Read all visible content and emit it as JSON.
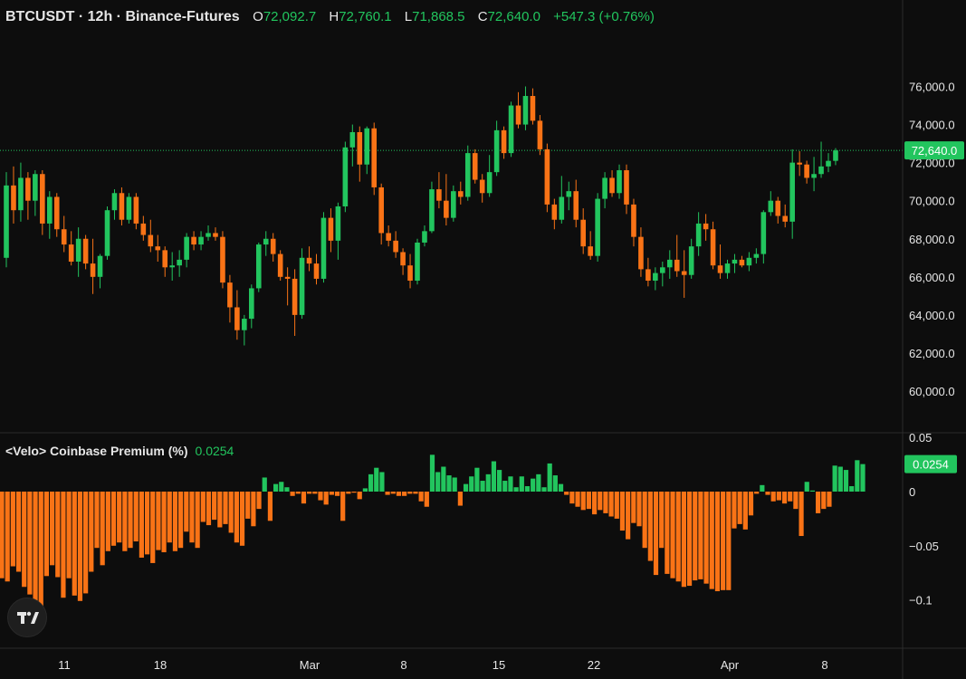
{
  "header": {
    "symbol": "BTCUSDT · 12h · Binance-Futures",
    "o_label": "O",
    "o": "72,092.7",
    "h_label": "H",
    "h": "72,760.1",
    "l_label": "L",
    "l": "71,868.5",
    "c_label": "C",
    "c": "72,640.0",
    "change": "+547.3 (+0.76%)"
  },
  "indicator": {
    "title": "<Velo> Coinbase Premium (%)",
    "value": "0.0254"
  },
  "colors": {
    "up": "#22c55e",
    "down": "#f97316",
    "bg": "#0d0d0d",
    "grid": "#2b2b2b",
    "text": "#e6e6e6"
  },
  "chart_data": [
    {
      "type": "candlestick",
      "ylim": [
        58000,
        76800
      ],
      "y_ticks": [
        "76,000.0",
        "74,000.0",
        "72,000.0",
        "70,000.0",
        "68,000.0",
        "66,000.0",
        "64,000.0",
        "62,000.0",
        "60,000.0"
      ],
      "last_price_label": "72,640.0",
      "last_price": 72640,
      "x_ticks": [
        "11",
        "18",
        "Mar",
        "8",
        "15",
        "22",
        "Apr",
        "8"
      ],
      "candles": [
        [
          67000,
          71500,
          66500,
          70800
        ],
        [
          70800,
          71800,
          68800,
          69500
        ],
        [
          69500,
          72000,
          68900,
          71200
        ],
        [
          71200,
          71500,
          69000,
          70000
        ],
        [
          70000,
          71600,
          69200,
          71400
        ],
        [
          71400,
          71600,
          68200,
          68800
        ],
        [
          68800,
          70500,
          68000,
          70200
        ],
        [
          70200,
          70400,
          68100,
          68500
        ],
        [
          68500,
          69200,
          67300,
          67700
        ],
        [
          67700,
          68400,
          66600,
          66800
        ],
        [
          66800,
          68600,
          66000,
          68000
        ],
        [
          68000,
          68200,
          66400,
          66700
        ],
        [
          66700,
          68000,
          65100,
          66000
        ],
        [
          66000,
          67200,
          65400,
          67100
        ],
        [
          67100,
          69700,
          66900,
          69500
        ],
        [
          69500,
          70600,
          69000,
          70400
        ],
        [
          70400,
          70700,
          68700,
          69000
        ],
        [
          69000,
          70400,
          68800,
          70200
        ],
        [
          70200,
          70400,
          68500,
          68800
        ],
        [
          68800,
          69200,
          67900,
          68200
        ],
        [
          68200,
          69000,
          67300,
          67600
        ],
        [
          67600,
          68200,
          66800,
          67400
        ],
        [
          67400,
          67600,
          66000,
          66500
        ],
        [
          66500,
          67300,
          65800,
          66600
        ],
        [
          66600,
          67400,
          66000,
          66900
        ],
        [
          66900,
          68300,
          66500,
          68100
        ],
        [
          68100,
          68400,
          67400,
          67700
        ],
        [
          67700,
          68400,
          67400,
          68100
        ],
        [
          68100,
          68700,
          67900,
          68300
        ],
        [
          68300,
          68600,
          67900,
          68100
        ],
        [
          68100,
          68400,
          65400,
          65700
        ],
        [
          65700,
          66100,
          63600,
          64400
        ],
        [
          64400,
          65300,
          62700,
          63200
        ],
        [
          63200,
          64000,
          62400,
          63800
        ],
        [
          63800,
          65600,
          63300,
          65400
        ],
        [
          65400,
          67800,
          65200,
          67700
        ],
        [
          67700,
          68400,
          67100,
          68000
        ],
        [
          68000,
          68300,
          66800,
          67200
        ],
        [
          67200,
          67400,
          65800,
          66000
        ],
        [
          66000,
          66500,
          64500,
          65900
        ],
        [
          65900,
          66400,
          62900,
          64000
        ],
        [
          64000,
          67500,
          63800,
          67000
        ],
        [
          67000,
          67600,
          66300,
          66700
        ],
        [
          66700,
          67200,
          65600,
          65900
        ],
        [
          65900,
          69400,
          65700,
          69100
        ],
        [
          69100,
          69600,
          67300,
          67900
        ],
        [
          67900,
          69900,
          66900,
          69700
        ],
        [
          69700,
          73100,
          69400,
          72800
        ],
        [
          72800,
          74000,
          71800,
          73600
        ],
        [
          73600,
          73900,
          71000,
          71900
        ],
        [
          71900,
          73900,
          71400,
          73800
        ],
        [
          73800,
          74100,
          70300,
          70700
        ],
        [
          70700,
          70900,
          67700,
          68300
        ],
        [
          68300,
          68700,
          67600,
          67900
        ],
        [
          67900,
          68400,
          67000,
          67300
        ],
        [
          67300,
          67500,
          66100,
          66600
        ],
        [
          66600,
          67200,
          65400,
          65800
        ],
        [
          65800,
          68000,
          65600,
          67800
        ],
        [
          67800,
          68700,
          67600,
          68400
        ],
        [
          68400,
          71000,
          68300,
          70600
        ],
        [
          70600,
          71500,
          69600,
          70000
        ],
        [
          70000,
          71400,
          68700,
          69100
        ],
        [
          69100,
          70800,
          68900,
          70500
        ],
        [
          70500,
          71000,
          69800,
          70200
        ],
        [
          70200,
          72900,
          70000,
          72500
        ],
        [
          72500,
          72700,
          70900,
          71100
        ],
        [
          71100,
          71400,
          69900,
          70400
        ],
        [
          70400,
          72400,
          70200,
          71500
        ],
        [
          71500,
          74200,
          71300,
          73700
        ],
        [
          73700,
          73900,
          72200,
          72500
        ],
        [
          72500,
          75200,
          72300,
          75000
        ],
        [
          75000,
          75700,
          73800,
          74000
        ],
        [
          74000,
          76000,
          73700,
          75500
        ],
        [
          75500,
          75900,
          74000,
          74200
        ],
        [
          74200,
          74500,
          72400,
          72700
        ],
        [
          72700,
          73000,
          69400,
          69800
        ],
        [
          69800,
          70100,
          68500,
          69000
        ],
        [
          69000,
          71300,
          68800,
          70200
        ],
        [
          70200,
          71000,
          69500,
          70500
        ],
        [
          70500,
          71100,
          68600,
          69000
        ],
        [
          69000,
          69600,
          67200,
          67600
        ],
        [
          67600,
          68400,
          66900,
          67100
        ],
        [
          67100,
          70400,
          66800,
          70100
        ],
        [
          70100,
          71500,
          69600,
          71200
        ],
        [
          71200,
          71600,
          70200,
          70400
        ],
        [
          70400,
          71900,
          70100,
          71600
        ],
        [
          71600,
          71900,
          69300,
          69800
        ],
        [
          69800,
          70100,
          67600,
          68100
        ],
        [
          68100,
          68600,
          66000,
          66400
        ],
        [
          66400,
          67000,
          65500,
          65800
        ],
        [
          65800,
          66500,
          65300,
          66200
        ],
        [
          66200,
          66800,
          65500,
          66500
        ],
        [
          66500,
          67400,
          65900,
          66900
        ],
        [
          66900,
          68200,
          66000,
          66300
        ],
        [
          66300,
          67400,
          64900,
          66100
        ],
        [
          66100,
          68000,
          65900,
          67600
        ],
        [
          67600,
          69400,
          67100,
          68800
        ],
        [
          68800,
          69300,
          67900,
          68500
        ],
        [
          68500,
          68900,
          66400,
          66600
        ],
        [
          66600,
          67700,
          65900,
          66200
        ],
        [
          66200,
          66900,
          65900,
          66700
        ],
        [
          66700,
          67200,
          66200,
          66900
        ],
        [
          66900,
          67100,
          66500,
          66600
        ],
        [
          66600,
          67300,
          66300,
          67000
        ],
        [
          67000,
          67500,
          66700,
          67200
        ],
        [
          67200,
          69500,
          66700,
          69400
        ],
        [
          69400,
          70500,
          69200,
          70000
        ],
        [
          70000,
          70200,
          68800,
          69200
        ],
        [
          69200,
          69800,
          68600,
          68900
        ],
        [
          68900,
          72700,
          68000,
          72000
        ],
        [
          72000,
          72600,
          71300,
          71900
        ],
        [
          71900,
          72100,
          70900,
          71200
        ],
        [
          71200,
          72300,
          70500,
          71400
        ],
        [
          71400,
          73100,
          71200,
          71800
        ],
        [
          71800,
          72500,
          71500,
          72092.7
        ],
        [
          72092.7,
          72760.1,
          71868.5,
          72640
        ]
      ]
    },
    {
      "type": "bar",
      "title": "<Velo> Coinbase Premium (%)",
      "ylim": [
        -0.145,
        0.05
      ],
      "y_ticks": [
        "0.05",
        "0",
        "−0.05",
        "−0.1"
      ],
      "last_value_label": "0.0254",
      "values": [
        -0.08,
        -0.083,
        -0.069,
        -0.074,
        -0.088,
        -0.095,
        -0.105,
        -0.112,
        -0.078,
        -0.068,
        -0.079,
        -0.098,
        -0.08,
        -0.096,
        -0.101,
        -0.094,
        -0.074,
        -0.052,
        -0.068,
        -0.055,
        -0.05,
        -0.047,
        -0.055,
        -0.052,
        -0.046,
        -0.061,
        -0.058,
        -0.066,
        -0.054,
        -0.056,
        -0.047,
        -0.055,
        -0.052,
        -0.037,
        -0.047,
        -0.052,
        -0.028,
        -0.031,
        -0.026,
        -0.033,
        -0.03,
        -0.038,
        -0.047,
        -0.05,
        -0.025,
        -0.032,
        -0.016,
        0.013,
        -0.027,
        0.007,
        0.009,
        0.004,
        -0.004,
        -0.002,
        -0.011,
        -0.002,
        -0.002,
        -0.008,
        -0.012,
        -0.003,
        -0.004,
        -0.027,
        -0.002,
        -0.001,
        -0.007,
        0.003,
        0.016,
        0.022,
        0.018,
        -0.003,
        -0.002,
        -0.004,
        -0.004,
        -0.002,
        -0.002,
        -0.009,
        -0.014,
        0.034,
        0.018,
        0.023,
        0.015,
        0.013,
        -0.013,
        0.007,
        0.014,
        0.022,
        0.01,
        0.016,
        0.028,
        0.02,
        0.01,
        0.014,
        0.004,
        0.014,
        0.005,
        0.012,
        0.016,
        0.004,
        0.026,
        0.015,
        0.007,
        -0.003,
        -0.011,
        -0.014,
        -0.017,
        -0.016,
        -0.021,
        -0.017,
        -0.02,
        -0.023,
        -0.025,
        -0.036,
        -0.044,
        -0.029,
        -0.032,
        -0.052,
        -0.064,
        -0.077,
        -0.052,
        -0.076,
        -0.08,
        -0.083,
        -0.088,
        -0.087,
        -0.082,
        -0.081,
        -0.085,
        -0.09,
        -0.092,
        -0.091,
        -0.091,
        -0.034,
        -0.03,
        -0.035,
        -0.022,
        -0.002,
        0.006,
        -0.003,
        -0.009,
        -0.008,
        -0.011,
        -0.009,
        -0.016,
        -0.041,
        0.009,
        0.001,
        -0.02,
        -0.016,
        -0.014,
        0.024,
        0.023,
        0.02,
        0.005,
        0.029,
        0.0254
      ]
    }
  ]
}
